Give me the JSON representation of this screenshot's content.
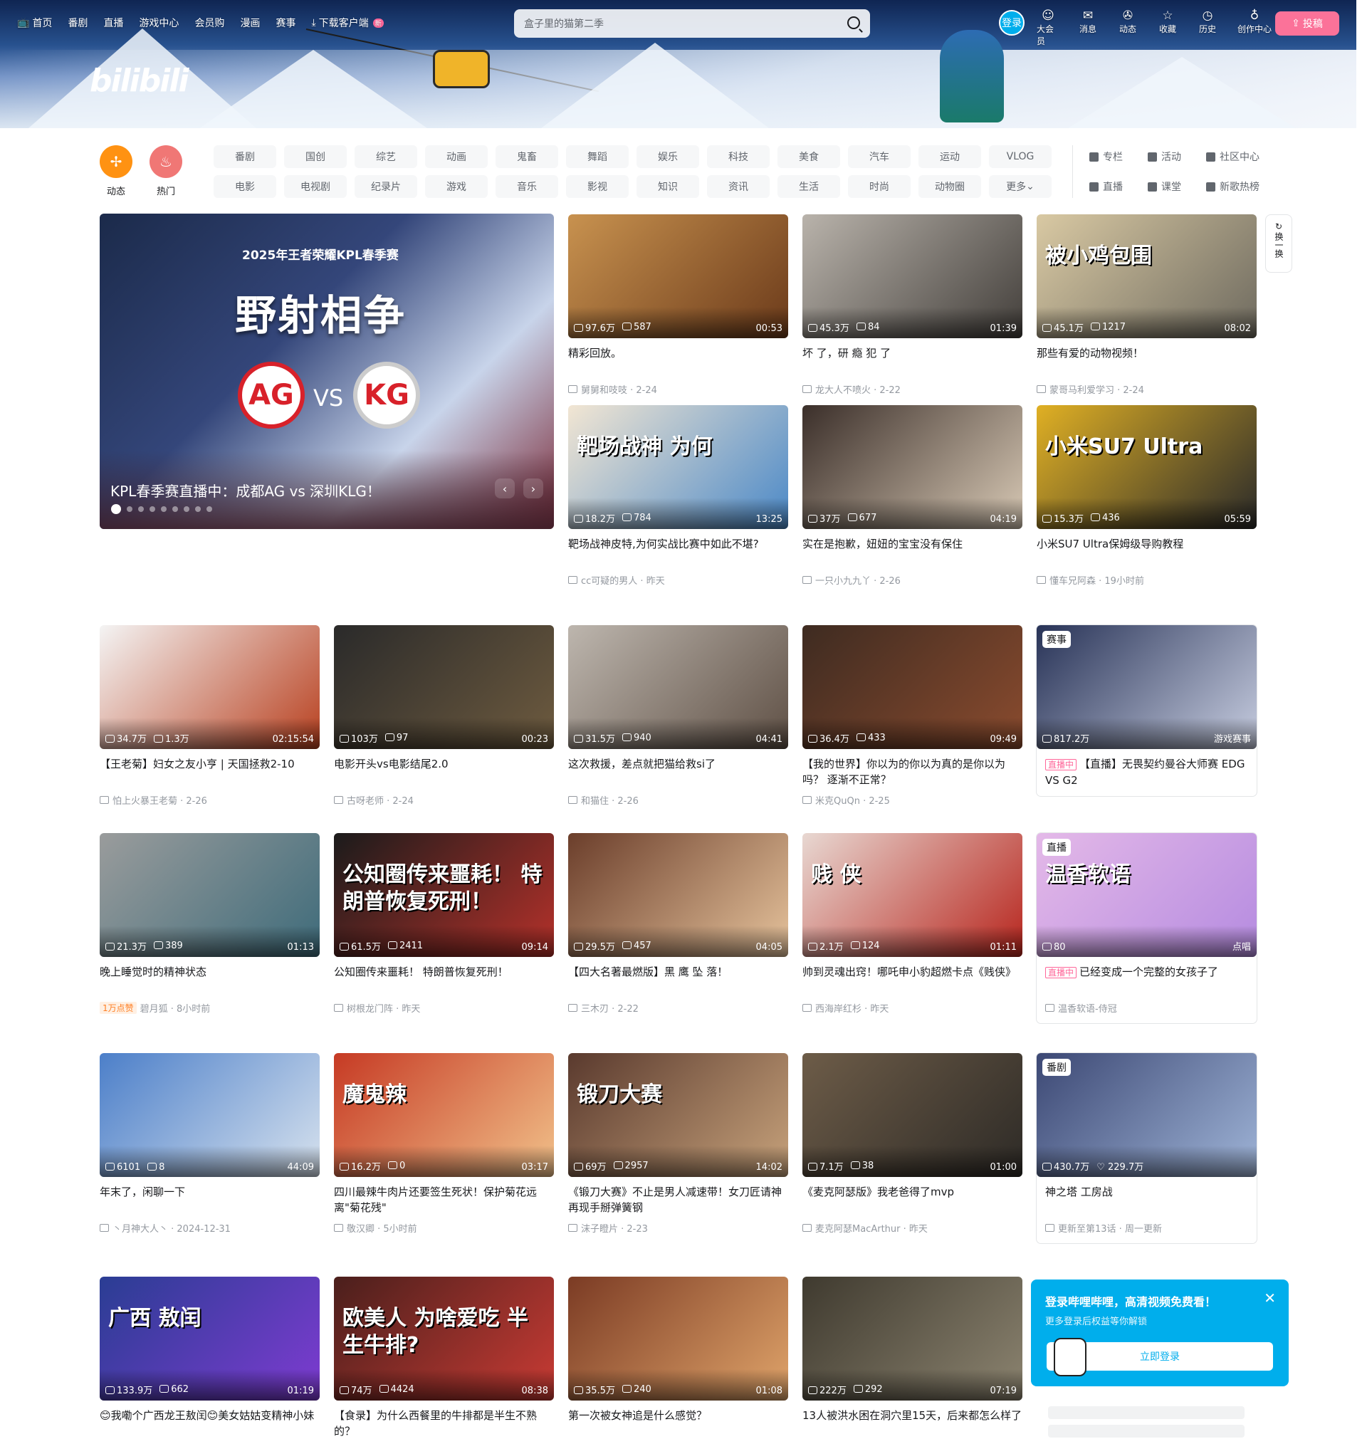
{
  "nav": {
    "left": [
      "首页",
      "番剧",
      "直播",
      "游戏中心",
      "会员购",
      "漫画",
      "赛事"
    ],
    "download": "下载客户端",
    "download_badge": "新",
    "search_placeholder": "盒子里的猫第二季",
    "login": "登录",
    "icons": [
      {
        "label": "大会员",
        "icon": "vip-icon"
      },
      {
        "label": "消息",
        "icon": "message-icon"
      },
      {
        "label": "动态",
        "icon": "dynamic-icon"
      },
      {
        "label": "收藏",
        "icon": "favorite-icon"
      },
      {
        "label": "历史",
        "icon": "history-icon"
      },
      {
        "label": "创作中心",
        "icon": "creator-icon"
      }
    ],
    "upload": "投稿"
  },
  "logo": "bilibili",
  "channels": {
    "dynamic": "动态",
    "hot": "热门",
    "tags": [
      "番剧",
      "国创",
      "综艺",
      "动画",
      "鬼畜",
      "舞蹈",
      "娱乐",
      "科技",
      "美食",
      "汽车",
      "运动",
      "VLOG",
      "电影",
      "电视剧",
      "纪录片",
      "游戏",
      "音乐",
      "影视",
      "知识",
      "资讯",
      "生活",
      "时尚",
      "动物圈",
      "更多"
    ],
    "side": [
      "专栏",
      "活动",
      "社区中心",
      "直播",
      "课堂",
      "新歌热榜"
    ]
  },
  "banner": {
    "league": "2025年王者荣耀KPL春季赛",
    "headline": "野射相争",
    "team1": "AG",
    "vs": "VS",
    "team2": "KG",
    "caption": "KPL春季赛直播中：成都AG vs 深圳KLG！"
  },
  "swap": "换一换",
  "cards": [
    {
      "title": "精彩回放。",
      "views": "97.6万",
      "dm": "587",
      "dur": "00:53",
      "up": "舅舅和吱吱",
      "date": "2-24"
    },
    {
      "title": "坏 了，研 瘾 犯 了",
      "views": "45.3万",
      "dm": "84",
      "dur": "01:39",
      "up": "龙大人不喷火",
      "date": "2-22"
    },
    {
      "title": "那些有爱的动物视频！",
      "views": "45.1万",
      "dm": "1217",
      "dur": "08:02",
      "up": "蒙哥马利爱学习",
      "date": "2-24",
      "overlay": "被小鸡包围"
    },
    {
      "title": "靶场战神皮特,为何实战比赛中如此不堪?",
      "views": "18.2万",
      "dm": "784",
      "dur": "13:25",
      "up": "cc可疑的男人",
      "date": "昨天",
      "overlay": "靶场战神 为何"
    },
    {
      "title": "实在是抱歉，妞妞的宝宝没有保住",
      "views": "37万",
      "dm": "677",
      "dur": "04:19",
      "up": "一只小九九丫",
      "date": "2-26"
    },
    {
      "title": "小米SU7 Ultra保姆级导购教程",
      "views": "15.3万",
      "dm": "436",
      "dur": "05:59",
      "up": "懂车兄阿森",
      "date": "19小时前",
      "overlay": "小米SU7 Ultra"
    },
    {
      "title": "【王老菊】妇女之友小亨 | 天国拯救2-10",
      "views": "34.7万",
      "dm": "1.3万",
      "dur": "02:15:54",
      "up": "怕上火暴王老菊",
      "date": "2-26"
    },
    {
      "title": "电影开头vs电影结尾2.0",
      "views": "103万",
      "dm": "97",
      "dur": "00:23",
      "up": "古呀老师",
      "date": "2-24"
    },
    {
      "title": "这次救援，差点就把猫给救si了",
      "views": "31.5万",
      "dm": "940",
      "dur": "04:41",
      "up": "和猫住",
      "date": "2-26"
    },
    {
      "title": "【我的世界】你以为的你以为真的是你以为吗？ 逐渐不正常？",
      "views": "36.4万",
      "dm": "433",
      "dur": "09:49",
      "up": "米克QuQn",
      "date": "2-25"
    },
    {
      "title": "【直播】无畏契约曼谷大师赛 EDG VS G2",
      "views": "817.2万",
      "corner": "赛事",
      "right": "游戏赛事",
      "live": "直播中",
      "up": "",
      "date": ""
    },
    {
      "title": "晚上睡觉时的精神状态",
      "views": "21.3万",
      "dm": "389",
      "dur": "01:13",
      "up": "碧月狐",
      "date": "8小时前",
      "hot": "1万点赞"
    },
    {
      "title": "公知圈传来噩耗！ 特朗普恢复死刑！",
      "views": "61.5万",
      "dm": "2411",
      "dur": "09:14",
      "up": "树根龙门阵",
      "date": "昨天",
      "overlay": "公知圈传来噩耗！ 特朗普恢复死刑！"
    },
    {
      "title": "【四大名著最燃版】黑 鹰 坠 落！",
      "views": "29.5万",
      "dm": "457",
      "dur": "04:05",
      "up": "三木刃",
      "date": "2-22"
    },
    {
      "title": "帅到灵魂出窍！哪吒申小豹超燃卡点《贱侠》",
      "views": "2.1万",
      "dm": "124",
      "dur": "01:11",
      "up": "西海岸红杉",
      "date": "昨天",
      "overlay": "贱 侠"
    },
    {
      "title": "已经变成一个完整的女孩子了",
      "views": "80",
      "corner": "直播",
      "right": "点唱",
      "live": "直播中",
      "up": "温香软语-侍冠",
      "date": "",
      "overlay": "温香软语"
    },
    {
      "title": "年末了，闲聊一下",
      "views": "6101",
      "dm": "8",
      "dur": "44:09",
      "up": "丶月神大人丶",
      "date": "2024-12-31"
    },
    {
      "title": "四川最辣牛肉片还要签生死状！保护菊花远离\"菊花残\"",
      "views": "16.2万",
      "dm": "0",
      "dur": "03:17",
      "up": "敬汉卿",
      "date": "5小时前",
      "overlay": "魔鬼辣"
    },
    {
      "title": "《锻刀大赛》不止是男人减速带！女刀匠请神 再现手掰弹簧钢",
      "views": "69万",
      "dm": "2957",
      "dur": "14:02",
      "up": "沫子瞪片",
      "date": "2-23",
      "overlay": "锻刀大赛"
    },
    {
      "title": "《麦克阿瑟版》我老爸得了mvp",
      "views": "7.1万",
      "dm": "38",
      "dur": "01:00",
      "up": "麦克阿瑟MacArthur",
      "date": "昨天"
    },
    {
      "title": "神之塔 工房战",
      "views": "430.7万",
      "likes": "229.7万",
      "corner": "番剧",
      "up": "更新至第13话 · 周一更新",
      "date": ""
    },
    {
      "title": "😊我嘞个广西龙王敖闰😊美女姑姑变精神小妹",
      "views": "133.9万",
      "dm": "662",
      "dur": "01:19",
      "up": "",
      "date": "",
      "overlay": "广西 敖闰"
    },
    {
      "title": "【食录】为什么西餐里的牛排都是半生不熟的？",
      "views": "74万",
      "dm": "4424",
      "dur": "08:38",
      "up": "",
      "date": "",
      "overlay": "欧美人 为啥爱吃 半生牛排?"
    },
    {
      "title": "第一次被女神追是什么感觉？",
      "views": "35.5万",
      "dm": "240",
      "dur": "01:08",
      "up": "",
      "date": ""
    },
    {
      "title": "13人被洪水困在洞穴里15天，后来都怎么样了",
      "views": "222万",
      "dm": "292",
      "dur": "07:19",
      "up": "",
      "date": ""
    }
  ],
  "popup": {
    "title": "登录哔哩哔哩，高清视频免费看！",
    "subtitle": "更多登录后权益等你解锁",
    "button": "立即登录"
  }
}
